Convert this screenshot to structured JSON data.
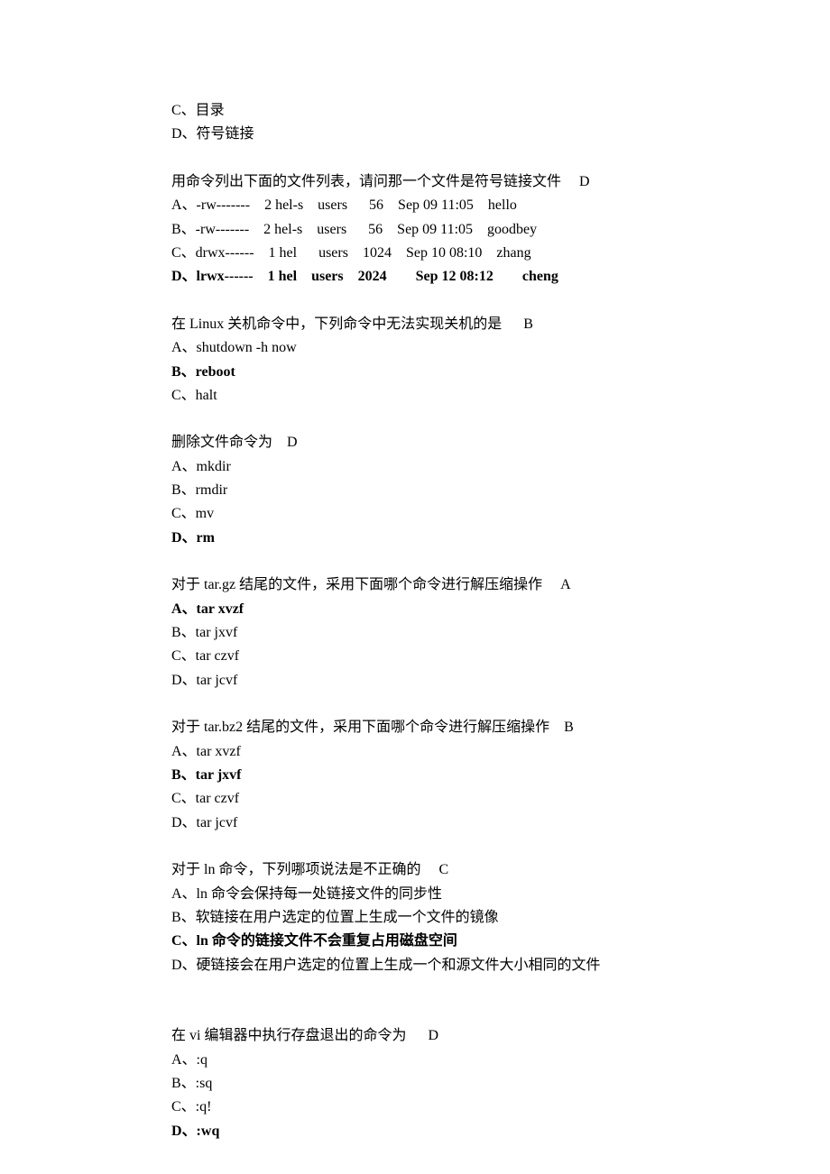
{
  "orphan": {
    "c": "C、目录",
    "d": "D、符号链接"
  },
  "q1": {
    "stem": "用命令列出下面的文件列表，请问那一个文件是符号链接文件     D",
    "a": "A、-rw-------    2 hel-s    users      56    Sep 09 11:05    hello",
    "b": "B、-rw-------    2 hel-s    users      56    Sep 09 11:05    goodbey",
    "c": "C、drwx------    1 hel      users    1024    Sep 10 08:10    zhang",
    "d": "D、lrwx------    1 hel    users    2024        Sep 12 08:12        cheng"
  },
  "q2": {
    "stem": "在 Linux 关机命令中，下列命令中无法实现关机的是      B",
    "a": "A、shutdown -h now",
    "b": "B、reboot",
    "c": "C、halt"
  },
  "q3": {
    "stem": "删除文件命令为    D",
    "a": "A、mkdir",
    "b": "B、rmdir",
    "c": "C、mv",
    "d": "D、rm"
  },
  "q4": {
    "stem": "对于 tar.gz 结尾的文件，采用下面哪个命令进行解压缩操作     A",
    "a": "A、tar xvzf",
    "b": "B、tar jxvf",
    "c": "C、tar czvf",
    "d": "D、tar jcvf"
  },
  "q5": {
    "stem": "对于 tar.bz2 结尾的文件，采用下面哪个命令进行解压缩操作    B",
    "a": "A、tar xvzf",
    "b": "B、tar jxvf",
    "c": "C、tar czvf",
    "d": "D、tar jcvf"
  },
  "q6": {
    "stem": "对于 ln 命令，下列哪项说法是不正确的     C",
    "a": "A、ln 命令会保持每一处链接文件的同步性",
    "b": "B、软链接在用户选定的位置上生成一个文件的镜像",
    "c": "C、ln 命令的链接文件不会重复占用磁盘空间",
    "d": "D、硬链接会在用户选定的位置上生成一个和源文件大小相同的文件"
  },
  "q7": {
    "stem": "在 vi 编辑器中执行存盘退出的命令为      D",
    "a": "A、:q",
    "b": "B、:sq",
    "c": "C、:q!",
    "d": "D、:wq"
  }
}
